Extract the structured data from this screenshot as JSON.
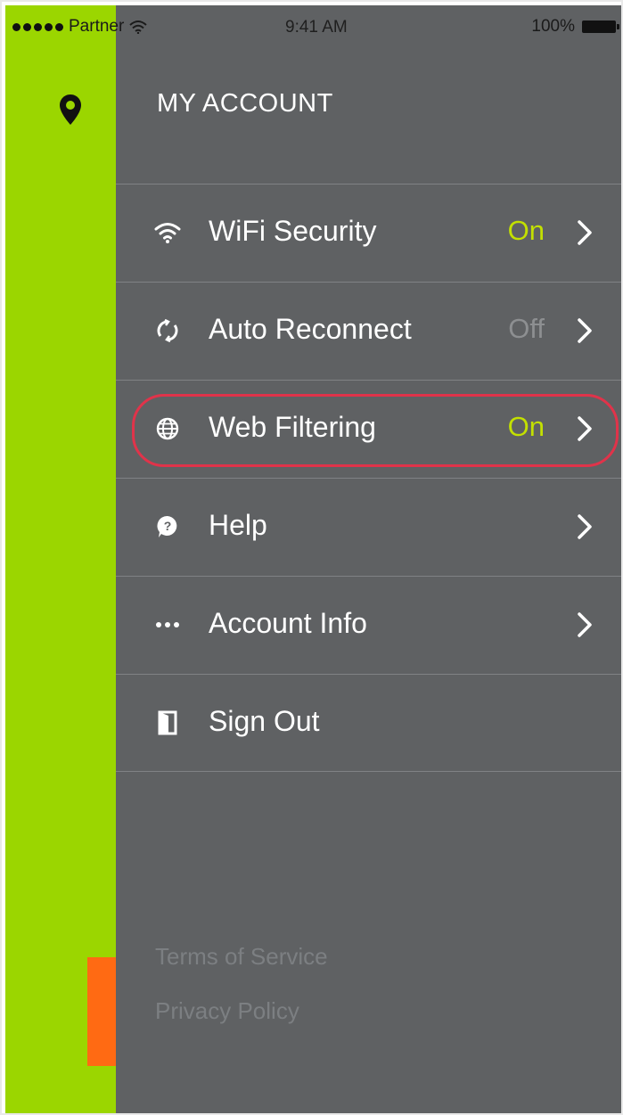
{
  "status_bar": {
    "carrier": "Partner",
    "time": "9:41 AM",
    "battery_percent": "100%",
    "signal_dots": 5
  },
  "drawer": {
    "title": "MY ACCOUNT",
    "items": [
      {
        "label": "WiFi Security",
        "status": "On",
        "icon": "wifi-icon"
      },
      {
        "label": "Auto Reconnect",
        "status": "Off",
        "icon": "reconnect-icon"
      },
      {
        "label": "Web Filtering",
        "status": "On",
        "icon": "globe-icon",
        "highlighted": true
      },
      {
        "label": "Help",
        "status": "",
        "icon": "help-icon"
      },
      {
        "label": "Account Info",
        "status": "",
        "icon": "more-icon"
      },
      {
        "label": "Sign Out",
        "status": "",
        "icon": "sign-out-icon"
      }
    ],
    "footer": {
      "terms": "Terms of Service",
      "privacy": "Privacy Policy"
    }
  },
  "colors": {
    "accent_green": "#9bd600",
    "status_on": "#c3e000",
    "drawer_bg": "#5f6163",
    "highlight": "#e0334a",
    "orange": "#ff6a13"
  }
}
